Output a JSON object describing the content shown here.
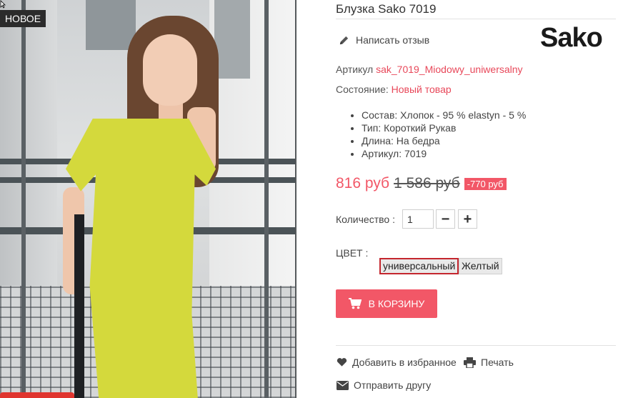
{
  "photo": {
    "badge": "НОВОЕ"
  },
  "product": {
    "title": "Блузка Sako 7019",
    "review_link": "Написать отзыв",
    "brand": "Sako",
    "sku_label": "Артикул",
    "sku_value": "sak_7019_Miodowy_uniwersalny",
    "condition_label": "Состояние:",
    "condition_value": "Новый товар",
    "features": [
      "Состав: Хлопок - 95 % elastyn - 5 %",
      "Тип: Короткий Рукав",
      "Длина: На бедра",
      "Артикул:  7019"
    ]
  },
  "price": {
    "current": "816 руб",
    "old": "1 586 руб",
    "discount": "-770 руб"
  },
  "quantity": {
    "label": "Количество :",
    "value": "1",
    "minus": "−",
    "plus": "+"
  },
  "color": {
    "label": "ЦВЕТ :",
    "options": [
      {
        "label": "универсальный",
        "selected": true
      },
      {
        "label": "Желтый",
        "selected": false
      }
    ]
  },
  "cart": {
    "label": "В КОРЗИНУ"
  },
  "actions": {
    "favorite": "Добавить в избранное",
    "print": "Печать",
    "send": "Отправить другу"
  },
  "colors": {
    "accent": "#f25767",
    "link": "#e8485a",
    "selected_border": "#c4262e"
  },
  "icons": [
    "pencil-icon",
    "cart-icon",
    "heart-icon",
    "printer-icon",
    "envelope-icon"
  ]
}
